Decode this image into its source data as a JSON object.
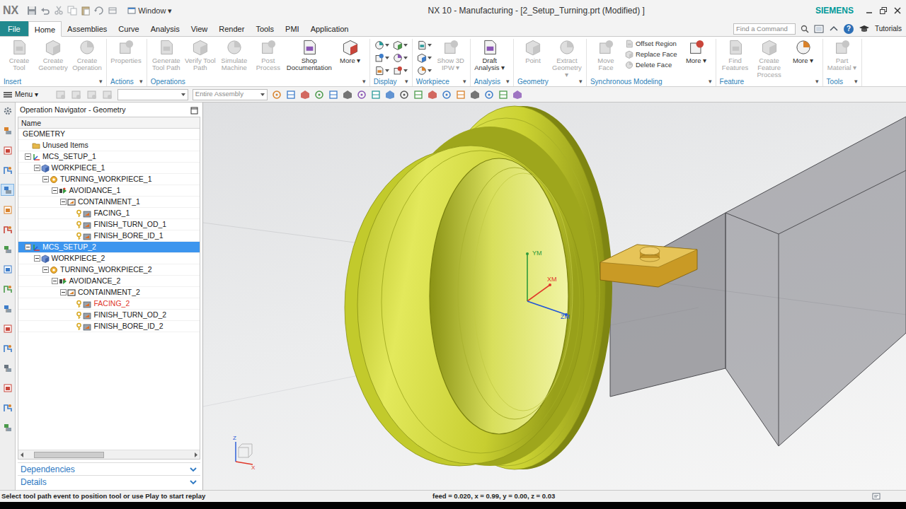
{
  "window": {
    "logo": "NX",
    "window_menu": "Window ▾",
    "title": "NX 10 - Manufacturing - [2_Setup_Turning.prt (Modified) ]",
    "brand": "SIEMENS"
  },
  "menu_tabs": [
    {
      "label": "File",
      "kind": "button",
      "selected": false
    },
    {
      "label": "Home",
      "kind": "tab",
      "selected": true
    },
    {
      "label": "Assemblies",
      "kind": "tab",
      "selected": false
    },
    {
      "label": "Curve",
      "kind": "tab",
      "selected": false
    },
    {
      "label": "Analysis",
      "kind": "tab",
      "selected": false
    },
    {
      "label": "View",
      "kind": "tab",
      "selected": false
    },
    {
      "label": "Render",
      "kind": "tab",
      "selected": false
    },
    {
      "label": "Tools",
      "kind": "tab",
      "selected": false
    },
    {
      "label": "PMI",
      "kind": "tab",
      "selected": false
    },
    {
      "label": "Application",
      "kind": "tab",
      "selected": false
    }
  ],
  "search": {
    "placeholder": "Find a Command"
  },
  "help": {
    "icon": "?",
    "tutorials": "Tutorials"
  },
  "ribbon": [
    {
      "label": "Insert",
      "menu": "▾",
      "items": [
        {
          "kind": "large",
          "label": "Create Tool",
          "disabled": true
        },
        {
          "kind": "large",
          "label": "Create Geometry",
          "disabled": true
        },
        {
          "kind": "large",
          "label": "Create Operation",
          "disabled": true
        }
      ]
    },
    {
      "label": "Actions",
      "menu": "▾",
      "items": [
        {
          "kind": "large",
          "label": "Properties",
          "disabled": true
        }
      ]
    },
    {
      "label": "Operations",
      "menu": "▾",
      "items": [
        {
          "kind": "large",
          "label": "Generate Tool Path",
          "disabled": true
        },
        {
          "kind": "large",
          "label": "Verify Tool Path",
          "disabled": true
        },
        {
          "kind": "large",
          "label": "Simulate Machine",
          "disabled": true
        },
        {
          "kind": "large",
          "label": "Post Process",
          "disabled": true
        },
        {
          "kind": "large",
          "label": "Shop Documentation",
          "disabled": false
        },
        {
          "kind": "large",
          "label": "More ▾",
          "disabled": false
        }
      ]
    },
    {
      "label": "Display",
      "menu": "▾",
      "items": [
        {
          "kind": "icon",
          "disabled": false
        },
        {
          "kind": "icon",
          "disabled": false
        },
        {
          "kind": "icon",
          "disabled": false
        },
        {
          "kind": "icon",
          "disabled": false
        },
        {
          "kind": "icon",
          "disabled": false
        },
        {
          "kind": "icon",
          "disabled": false
        }
      ]
    },
    {
      "label": "Workpiece",
      "menu": "▾",
      "items": [
        {
          "kind": "icon",
          "disabled": false
        },
        {
          "kind": "icon",
          "disabled": false
        },
        {
          "kind": "icon",
          "disabled": false
        },
        {
          "kind": "large",
          "label": "Show 3D IPW ▾",
          "disabled": true
        }
      ]
    },
    {
      "label": "Analysis",
      "menu": "▾",
      "items": [
        {
          "kind": "large",
          "label": "Draft Analysis ▾",
          "disabled": false
        }
      ]
    },
    {
      "label": "Geometry",
      "menu": "▾",
      "items": [
        {
          "kind": "large",
          "label": "Point",
          "disabled": true
        },
        {
          "kind": "large",
          "label": "Extract Geometry ▾",
          "disabled": true
        }
      ]
    },
    {
      "label": "Synchronous Modeling",
      "menu": "▾",
      "items": [
        {
          "kind": "large",
          "label": "Move Face",
          "disabled": true
        },
        {
          "kind": "small",
          "label": "Offset Region",
          "disabled": true
        },
        {
          "kind": "small",
          "label": "Replace Face",
          "disabled": true
        },
        {
          "kind": "small",
          "label": "Delete Face",
          "disabled": true
        },
        {
          "kind": "large",
          "label": "More ▾",
          "disabled": false
        }
      ]
    },
    {
      "label": "Feature",
      "menu": "▾",
      "items": [
        {
          "kind": "large",
          "label": "Find Features",
          "disabled": true
        },
        {
          "kind": "large",
          "label": "Create Feature Process",
          "disabled": true
        },
        {
          "kind": "large",
          "label": "More ▾",
          "disabled": false
        }
      ]
    },
    {
      "label": "Tools",
      "menu": "▾",
      "items": [
        {
          "kind": "large",
          "label": "Part Material ▾",
          "disabled": true
        }
      ]
    }
  ],
  "toolbar": {
    "menu": "Menu ▾",
    "scope": "Entire Assembly"
  },
  "resource_bar": [
    {
      "selected": false
    },
    {
      "selected": false
    },
    {
      "selected": false
    },
    {
      "selected": false
    },
    {
      "selected": true
    },
    {
      "selected": false
    },
    {
      "selected": false
    },
    {
      "selected": false
    },
    {
      "selected": false
    },
    {
      "selected": false
    },
    {
      "selected": false
    },
    {
      "selected": false
    },
    {
      "selected": false
    },
    {
      "selected": false
    },
    {
      "selected": false
    },
    {
      "selected": false
    },
    {
      "selected": false
    }
  ],
  "navigator": {
    "title": "Operation Navigator - Geometry",
    "column": "Name",
    "rows": [
      {
        "label": "GEOMETRY",
        "depth": 0,
        "kind": "root",
        "expandable": false,
        "expanded": false,
        "selected": false,
        "color": "#222222"
      },
      {
        "label": "Unused Items",
        "depth": 1,
        "kind": "folder",
        "expandable": false,
        "expanded": false,
        "selected": false,
        "color": "#222222"
      },
      {
        "label": "MCS_SETUP_1",
        "depth": 1,
        "kind": "mcs",
        "expandable": true,
        "expanded": true,
        "selected": false,
        "color": "#222222"
      },
      {
        "label": "WORKPIECE_1",
        "depth": 2,
        "kind": "workpiece",
        "expandable": true,
        "expanded": true,
        "selected": false,
        "color": "#222222"
      },
      {
        "label": "TURNING_WORKPIECE_1",
        "depth": 3,
        "kind": "turning",
        "expandable": true,
        "expanded": true,
        "selected": false,
        "color": "#222222"
      },
      {
        "label": "AVOIDANCE_1",
        "depth": 4,
        "kind": "avoidance",
        "expandable": true,
        "expanded": true,
        "selected": false,
        "color": "#222222"
      },
      {
        "label": "CONTAINMENT_1",
        "depth": 5,
        "kind": "containment",
        "expandable": true,
        "expanded": true,
        "selected": false,
        "color": "#222222"
      },
      {
        "label": "FACING_1",
        "depth": 6,
        "kind": "operation",
        "expandable": false,
        "expanded": false,
        "selected": false,
        "color": "#222222"
      },
      {
        "label": "FINISH_TURN_OD_1",
        "depth": 6,
        "kind": "operation",
        "expandable": false,
        "expanded": false,
        "selected": false,
        "color": "#222222"
      },
      {
        "label": "FINISH_BORE_ID_1",
        "depth": 6,
        "kind": "operation",
        "expandable": false,
        "expanded": false,
        "selected": false,
        "color": "#222222"
      },
      {
        "label": "MCS_SETUP_2",
        "depth": 1,
        "kind": "mcs",
        "expandable": true,
        "expanded": true,
        "selected": true,
        "color": "#ffffff"
      },
      {
        "label": "WORKPIECE_2",
        "depth": 2,
        "kind": "workpiece",
        "expandable": true,
        "expanded": true,
        "selected": false,
        "color": "#222222"
      },
      {
        "label": "TURNING_WORKPIECE_2",
        "depth": 3,
        "kind": "turning",
        "expandable": true,
        "expanded": true,
        "selected": false,
        "color": "#222222"
      },
      {
        "label": "AVOIDANCE_2",
        "depth": 4,
        "kind": "avoidance",
        "expandable": true,
        "expanded": true,
        "selected": false,
        "color": "#222222"
      },
      {
        "label": "CONTAINMENT_2",
        "depth": 5,
        "kind": "containment",
        "expandable": true,
        "expanded": true,
        "selected": false,
        "color": "#222222"
      },
      {
        "label": "FACING_2",
        "depth": 6,
        "kind": "operation",
        "expandable": false,
        "expanded": false,
        "selected": false,
        "color": "#e0342a"
      },
      {
        "label": "FINISH_TURN_OD_2",
        "depth": 6,
        "kind": "operation",
        "expandable": false,
        "expanded": false,
        "selected": false,
        "color": "#222222"
      },
      {
        "label": "FINISH_BORE_ID_2",
        "depth": 6,
        "kind": "operation",
        "expandable": false,
        "expanded": false,
        "selected": false,
        "color": "#222222"
      }
    ],
    "hscroll": {
      "level": 0.42
    },
    "sections": [
      {
        "label": "Dependencies",
        "expanded": false
      },
      {
        "label": "Details",
        "expanded": false
      }
    ]
  },
  "viewport": {
    "axes": [
      {
        "label": "YM",
        "color": "#2f9a3a"
      },
      {
        "label": "XM",
        "color": "#e0382a"
      },
      {
        "label": "ZM",
        "color": "#2256d6"
      }
    ],
    "triad": [
      {
        "label": "Z",
        "color": "#2256d6"
      },
      {
        "label": "X",
        "color": "#e0382a"
      }
    ]
  },
  "status_bar": {
    "message": "Select tool path event to position tool or use Play to start replay",
    "readout": "feed = 0.020, x = 0.99, y = 0.00, z = 0.03"
  }
}
